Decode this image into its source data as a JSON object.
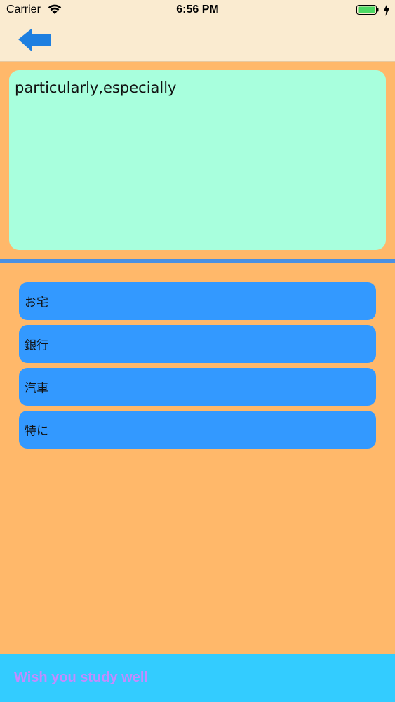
{
  "status_bar": {
    "carrier": "Carrier",
    "time": "6:56 PM"
  },
  "nav": {
    "back_icon": "arrow-left-icon"
  },
  "word_card": {
    "text": "particularly,especially"
  },
  "options": [
    {
      "label": "お宅"
    },
    {
      "label": "銀行"
    },
    {
      "label": "汽車"
    },
    {
      "label": "特に"
    }
  ],
  "footer": {
    "text": "Wish you study well"
  },
  "colors": {
    "background": "#FFB86A",
    "nav_background": "#FAEBD0",
    "card": "#A8FFDD",
    "divider": "#4A90E2",
    "option": "#3399FF",
    "footer": "#33CCFF",
    "footer_text": "#C38BFF",
    "battery": "#4CD964"
  }
}
